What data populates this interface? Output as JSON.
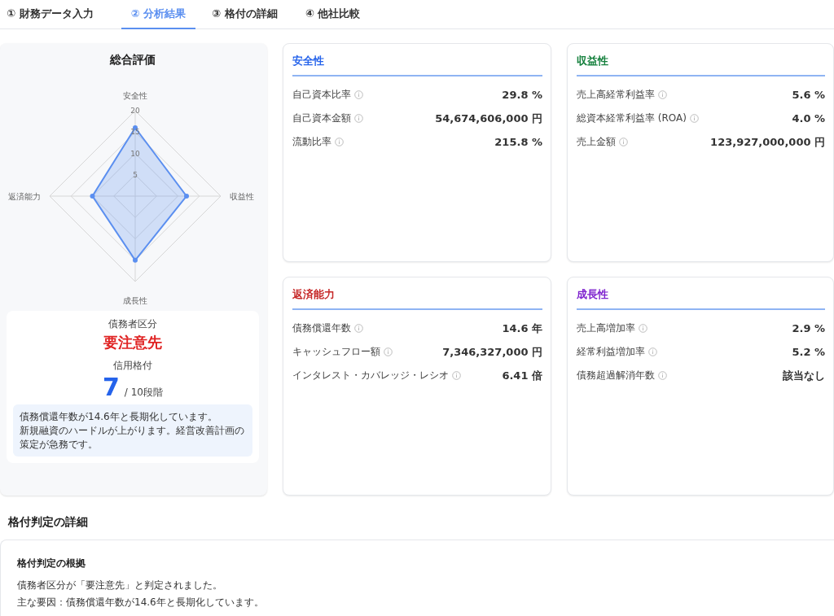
{
  "tabs": [
    {
      "label": "① 財務データ入力",
      "selected": false
    },
    {
      "label": "② 分析結果",
      "selected": true
    },
    {
      "label": "③ 格付の詳細",
      "selected": false
    },
    {
      "label": "④ 他社比較",
      "selected": false
    }
  ],
  "overall": {
    "title": "総合評価",
    "radar": {
      "axes": [
        {
          "label": "安全性"
        },
        {
          "label": "収益性"
        },
        {
          "label": "成長性"
        },
        {
          "label": "返済能力"
        }
      ],
      "ticks": [
        "20",
        "15",
        "10",
        "5"
      ]
    },
    "debtor_label": "債務者区分",
    "debtor_class": "要注意先",
    "rating_label": "信用格付",
    "rating": "7",
    "rating_scale": "/ 10段階",
    "note": [
      "債務償還年数が14.6年と長期化しています。",
      "新規融資のハードルが上がります。経営改善計画の策定が急務です。"
    ]
  },
  "cards": [
    {
      "title": "安全性",
      "color": "#2563eb",
      "rows": [
        {
          "label": "自己資本比率",
          "value": "29.8 %"
        },
        {
          "label": "自己資本金額",
          "value": "54,674,606,000 円"
        },
        {
          "label": "流動比率",
          "value": "215.8 %"
        }
      ]
    },
    {
      "title": "収益性",
      "color": "#15803d",
      "rows": [
        {
          "label": "売上高経常利益率",
          "value": "5.6 %"
        },
        {
          "label": "総資本経常利益率 (ROA)",
          "value": "4.0 %"
        },
        {
          "label": "売上金額",
          "value": "123,927,000,000 円"
        }
      ]
    },
    {
      "title": "返済能力",
      "color": "#c62828",
      "rows": [
        {
          "label": "債務償還年数",
          "value": "14.6 年"
        },
        {
          "label": "キャッシュフロー額",
          "value": "7,346,327,000 円"
        },
        {
          "label": "インタレスト・カバレッジ・レシオ",
          "value": "6.41 倍"
        }
      ]
    },
    {
      "title": "成長性",
      "color": "#7e22ce",
      "rows": [
        {
          "label": "売上高増加率",
          "value": "2.9 %"
        },
        {
          "label": "経常利益増加率",
          "value": "5.2 %"
        },
        {
          "label": "債務超過解消年数",
          "value": "該当なし"
        }
      ]
    }
  ],
  "details": {
    "heading": "格付判定の詳細",
    "title": "格付判定の根拠",
    "lines": [
      "債務者区分が「要注意先」と判定されました。",
      "主な要因：債務償還年数が14.6年と長期化しています。"
    ]
  }
}
